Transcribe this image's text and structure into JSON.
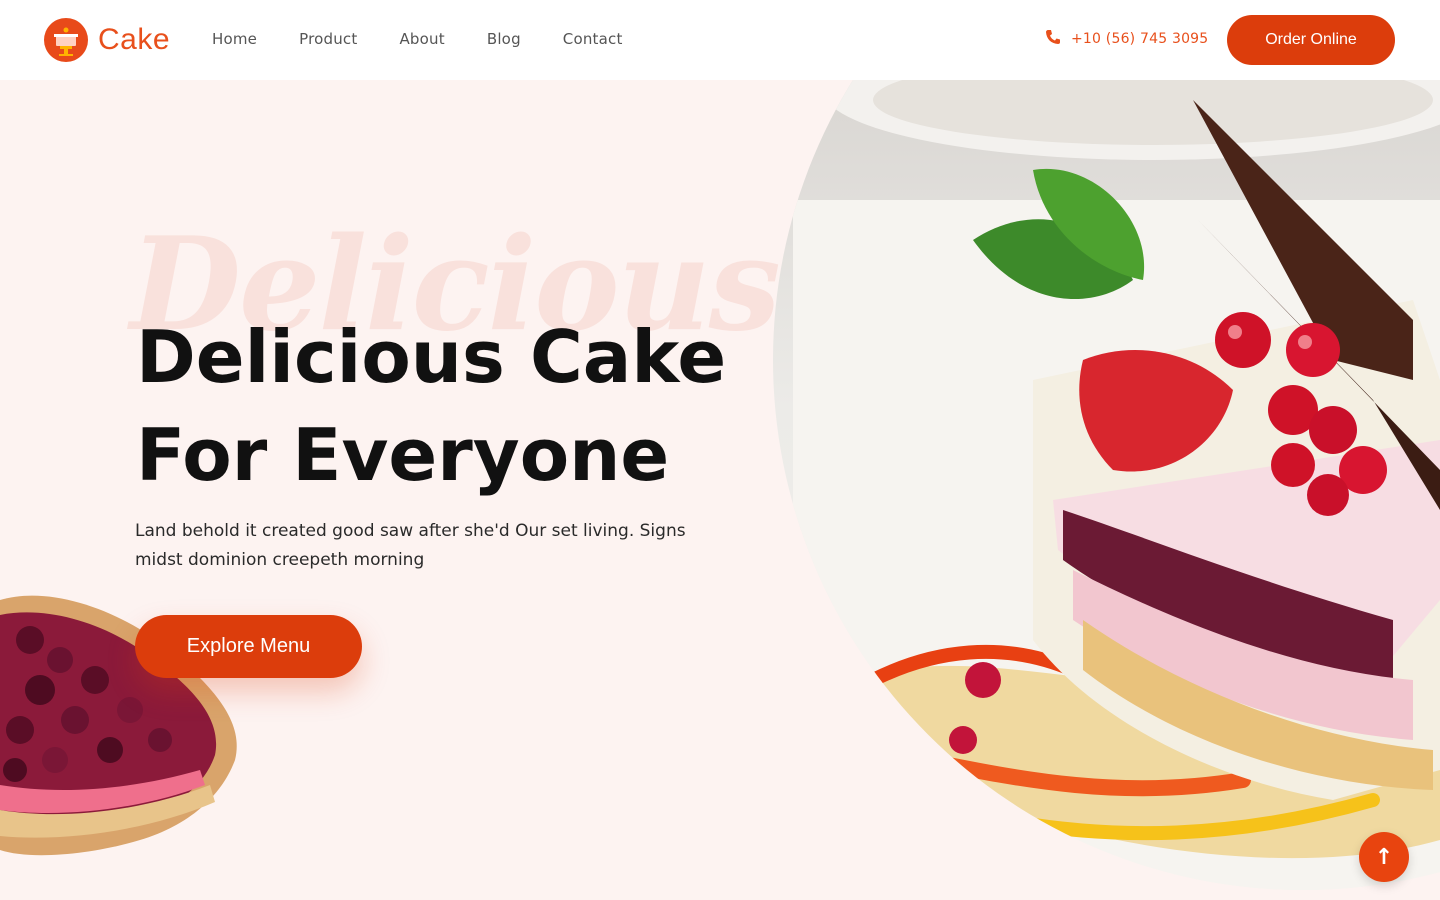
{
  "brand": {
    "name": "Cake",
    "logo_icon": "cake-logo-icon",
    "accent": "#dc3d0c"
  },
  "nav": {
    "items": [
      {
        "label": "Home"
      },
      {
        "label": "Product"
      },
      {
        "label": "About"
      },
      {
        "label": "Blog"
      },
      {
        "label": "Contact"
      }
    ]
  },
  "header": {
    "phone": "+10 (56) 745 3095",
    "phone_icon": "phone-icon",
    "order_label": "Order Online"
  },
  "hero": {
    "watermark": "Delicious",
    "headline_line1": "Delicious Cake",
    "headline_line2": "For Everyone",
    "subtext": "Land behold it created good saw after she'd Our set living. Signs midst dominion creepeth morning",
    "cta_label": "Explore Menu",
    "background": "#fdf3f1"
  },
  "scroll_top": {
    "icon": "arrow-up-icon",
    "glyph": "↑"
  }
}
